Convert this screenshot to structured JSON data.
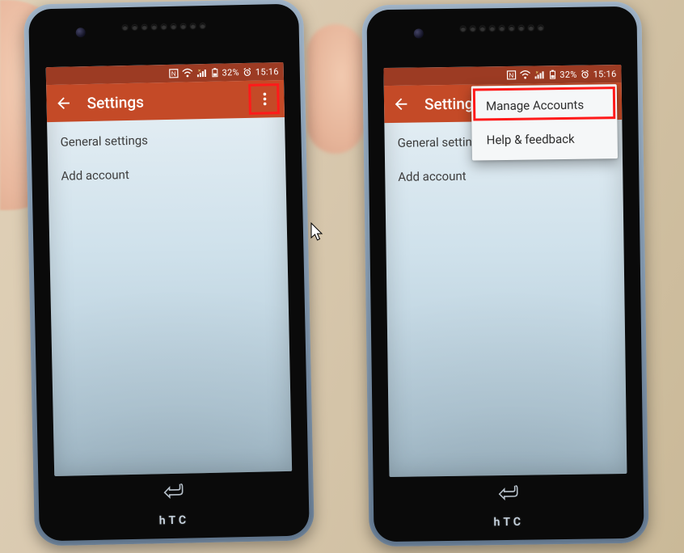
{
  "statusbar": {
    "nfc": "N",
    "battery_pct": "32%",
    "time": "15:16"
  },
  "appbar": {
    "title": "Settings"
  },
  "list": {
    "items": [
      {
        "label": "General settings"
      },
      {
        "label": "Add account"
      }
    ]
  },
  "popup": {
    "items": [
      {
        "label": "Manage Accounts"
      },
      {
        "label": "Help & feedback"
      }
    ]
  },
  "brand": "hTC"
}
